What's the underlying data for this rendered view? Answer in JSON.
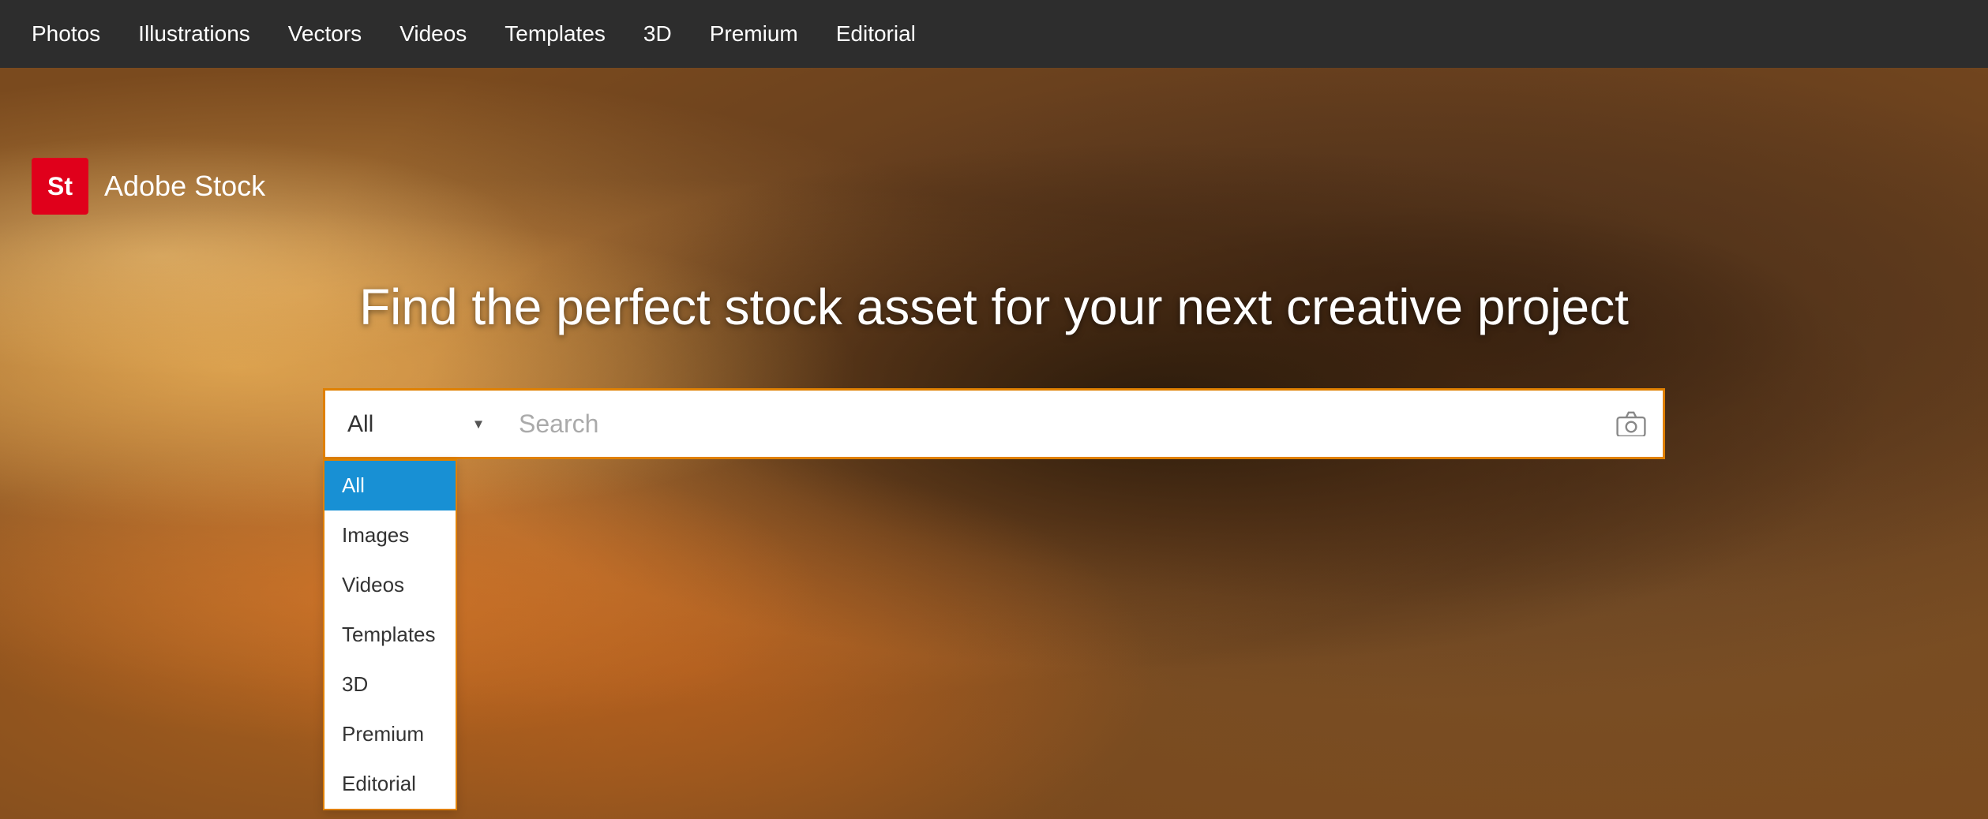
{
  "nav": {
    "items": [
      {
        "label": "Photos",
        "id": "photos"
      },
      {
        "label": "Illustrations",
        "id": "illustrations"
      },
      {
        "label": "Vectors",
        "id": "vectors"
      },
      {
        "label": "Videos",
        "id": "videos"
      },
      {
        "label": "Templates",
        "id": "templates"
      },
      {
        "label": "3D",
        "id": "3d"
      },
      {
        "label": "Premium",
        "id": "premium"
      },
      {
        "label": "Editorial",
        "id": "editorial"
      }
    ]
  },
  "logo": {
    "badge_text": "St",
    "brand_name": "Adobe Stock"
  },
  "hero": {
    "headline": "Find the perfect stock asset for your next creative project"
  },
  "search": {
    "placeholder": "Search",
    "dropdown_label": "All",
    "dropdown_arrow": "▾",
    "options": [
      {
        "label": "All",
        "value": "all",
        "selected": true
      },
      {
        "label": "Images",
        "value": "images"
      },
      {
        "label": "Videos",
        "value": "videos"
      },
      {
        "label": "Templates",
        "value": "templates"
      },
      {
        "label": "3D",
        "value": "3d"
      },
      {
        "label": "Premium",
        "value": "premium"
      },
      {
        "label": "Editorial",
        "value": "editorial"
      }
    ]
  }
}
